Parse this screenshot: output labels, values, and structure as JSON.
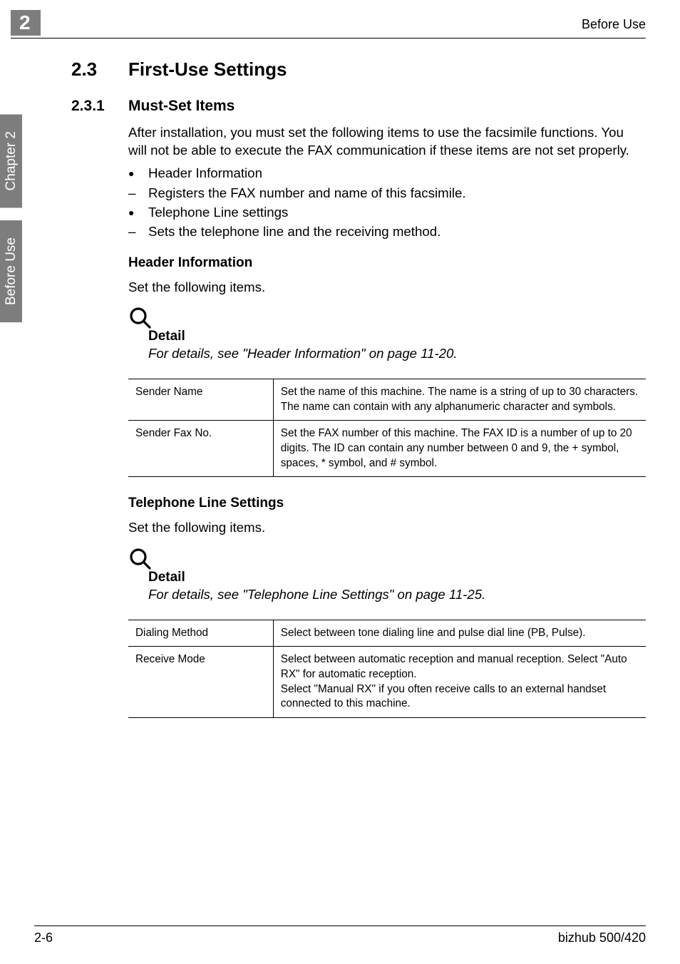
{
  "header": {
    "chapter_number": "2",
    "right": "Before Use"
  },
  "side_tabs": [
    "Chapter 2",
    "Before Use"
  ],
  "sections": {
    "h1_num": "2.3",
    "h1_title": "First-Use Settings",
    "h2_num": "2.3.1",
    "h2_title": "Must-Set Items",
    "intro": "After installation, you must set the following items to use the facsimile functions. You will not be able to execute the FAX communication if these items are not set properly.",
    "bullets": {
      "b1": "Header Information",
      "d1": "Registers the FAX number and name of this facsimile.",
      "b2": "Telephone Line settings",
      "d2": "Sets the telephone line and the receiving method."
    },
    "header_info_heading": "Header Information",
    "set_following": "Set the following items.",
    "detail_label": "Detail",
    "detail1": "For details, see \"Header Information\" on page 11-20.",
    "table1": {
      "r1c1": "Sender Name",
      "r1c2": "Set the name of this machine. The name is a string of up to 30 characters. The name can contain with any alphanumeric character and symbols.",
      "r2c1": "Sender Fax No.",
      "r2c2": "Set the FAX number of this machine. The FAX ID is a number of up to 20 digits. The ID can contain any number between 0 and 9, the + symbol, spaces, * symbol, and # symbol."
    },
    "tel_heading": "Telephone Line Settings",
    "detail2": "For details, see \"Telephone Line Settings\" on page 11-25.",
    "table2": {
      "r1c1": "Dialing Method",
      "r1c2": "Select between tone dialing line and pulse dial line (PB, Pulse).",
      "r2c1": "Receive Mode",
      "r2c2": "Select between automatic reception and manual reception. Select \"Auto RX\" for automatic reception.\nSelect \"Manual RX\" if you often receive calls to an external handset connected to this machine."
    }
  },
  "footer": {
    "left": "2-6",
    "right": "bizhub 500/420"
  }
}
